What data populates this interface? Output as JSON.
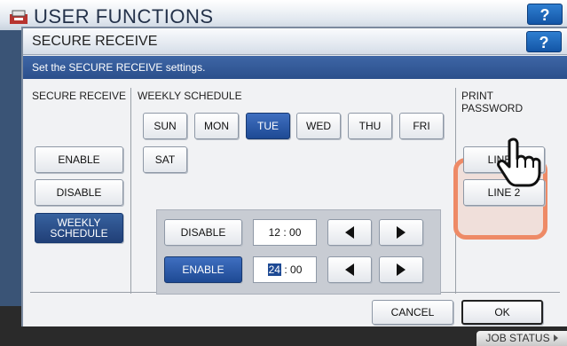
{
  "background": {
    "title": "USER FUNCTIONS",
    "help_label": "?",
    "job_status_label": "JOB STATUS"
  },
  "dialog": {
    "title": "SECURE RECEIVE",
    "help_label": "?",
    "info_text": "Set the SECURE RECEIVE settings.",
    "secure_receive": {
      "heading": "SECURE RECEIVE",
      "enable_label": "ENABLE",
      "disable_label": "DISABLE",
      "weekly_line1": "WEEKLY",
      "weekly_line2": "SCHEDULE",
      "selected": "WEEKLY SCHEDULE"
    },
    "weekly_schedule": {
      "heading": "WEEKLY SCHEDULE",
      "days": [
        "SUN",
        "MON",
        "TUE",
        "WED",
        "THU",
        "FRI",
        "SAT"
      ],
      "selected_day": "TUE",
      "disable_label": "DISABLE",
      "disable_hour": "12",
      "disable_minute": "00",
      "enable_label": "ENABLE",
      "enable_hour": "24",
      "enable_minute": "00",
      "time_separator": ":",
      "selected_mode": "ENABLE"
    },
    "print_password": {
      "heading_line1": "PRINT",
      "heading_line2": "PASSWORD",
      "line1_label": "LINE 1",
      "line2_label": "LINE 2"
    },
    "footer": {
      "cancel_label": "CANCEL",
      "ok_label": "OK"
    }
  },
  "colors": {
    "selected_blue": "#1e4a94",
    "info_bar": "#2b4f8b",
    "callout": "#ee8a66"
  }
}
